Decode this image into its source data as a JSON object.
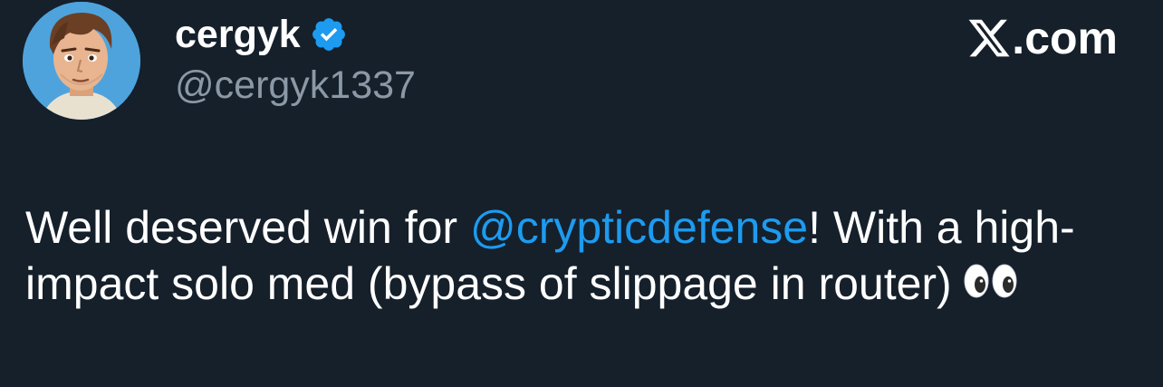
{
  "author": {
    "display_name": "cergyk",
    "handle": "@cergyk1337",
    "verified": true,
    "avatar_icon": "cartoon-avatar-icon"
  },
  "brand": {
    "label": ".com",
    "logo_icon": "x-logo-icon"
  },
  "tweet": {
    "text_before_mention": "Well deserved win for ",
    "mention": "@crypticdefense",
    "text_after_mention": "! With a high-impact solo med (bypass of slippage in router)",
    "emoji_icon": "eyes-emoji-icon"
  },
  "colors": {
    "background": "#15202b",
    "text": "#ffffff",
    "secondary_text": "#8b98a5",
    "accent": "#1d9bf0"
  }
}
